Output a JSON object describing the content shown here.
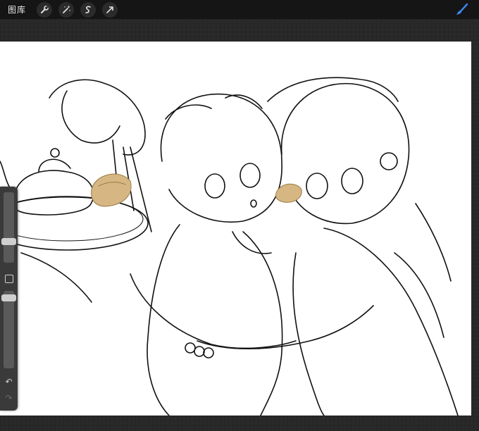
{
  "topbar": {
    "gallery_label": "图库",
    "tools": [
      {
        "name": "wrench-icon"
      },
      {
        "name": "magic-wand-icon"
      },
      {
        "name": "selection-icon"
      },
      {
        "name": "transform-arrow-icon"
      }
    ],
    "active_tool": "brush-icon",
    "accent_color": "#3a8dff"
  },
  "sidebar": {
    "brush_size": 0.28,
    "opacity": 0.29,
    "undo_icon": "undo-icon",
    "redo_icon": "redo-icon"
  },
  "canvas": {
    "background": "#ffffff",
    "fill_color": "#d6b682"
  }
}
